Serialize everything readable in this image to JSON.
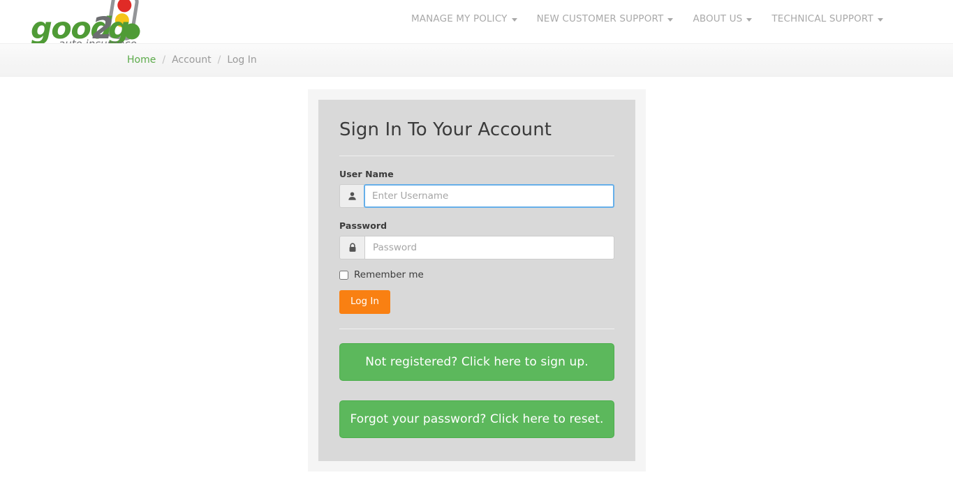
{
  "brand": {
    "name": "good2go",
    "word_part_1": "good",
    "word_part_2": "2",
    "word_part_3": "g",
    "tagline": "auto insurance",
    "green": "#4f9b36",
    "gray": "#6d6e71",
    "red_light": "#e02b26",
    "yellow_light": "#f5c518",
    "green_light": "#4f9b36"
  },
  "nav": {
    "items": [
      {
        "label": "MANAGE MY POLICY",
        "has_caret": true
      },
      {
        "label": "NEW CUSTOMER SUPPORT",
        "has_caret": true
      },
      {
        "label": "ABOUT US",
        "has_caret": true
      },
      {
        "label": "TECHNICAL SUPPORT",
        "has_caret": true
      }
    ]
  },
  "breadcrumb": {
    "home": "Home",
    "sep1": "/",
    "account": "Account",
    "sep2": "/",
    "current": "Log In"
  },
  "login_card": {
    "title": "Sign In To Your Account",
    "username": {
      "label": "User Name",
      "placeholder": "Enter Username",
      "value": "",
      "icon": "user-icon",
      "focused": true
    },
    "password": {
      "label": "Password",
      "placeholder": "Password",
      "value": "",
      "icon": "lock-icon",
      "focused": false
    },
    "remember": {
      "label": "Remember me",
      "checked": false
    },
    "login_button": "Log In",
    "signup_button": "Not registered? Click here to sign up.",
    "reset_button": "Forgot your password? Click here to reset."
  },
  "colors": {
    "orange": "#f98012",
    "green_button": "#5cb85c",
    "link_green": "#5cab4a",
    "card_bg": "#d9d9d9",
    "panel_bg": "#f5f5f5",
    "focus_blue": "#66afe9"
  }
}
